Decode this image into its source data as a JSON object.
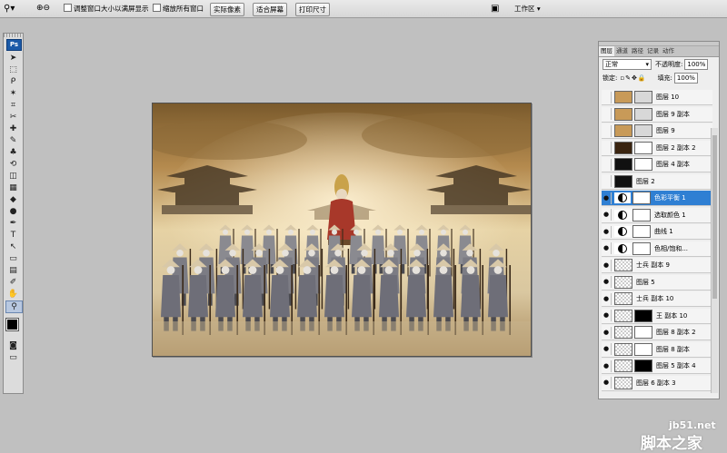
{
  "options_bar": {
    "zoom_tool_icon": "magnifier-icon",
    "resize_windows_label": "调整窗口大小以满屏显示",
    "zoom_all_windows_label": "缩放所有窗口",
    "actual_pixels_label": "实际像素",
    "fit_screen_label": "适合屏幕",
    "print_size_label": "打印尺寸",
    "workspace_label": "工作区 ▾"
  },
  "toolbox": {
    "ps_logo": "Ps",
    "tools": [
      "move-icon",
      "marquee-icon",
      "lasso-icon",
      "magic-wand-icon",
      "crop-icon",
      "slice-icon",
      "healing-brush-icon",
      "brush-icon",
      "clone-stamp-icon",
      "history-brush-icon",
      "eraser-icon",
      "gradient-icon",
      "blur-icon",
      "dodge-icon",
      "pen-icon",
      "type-icon",
      "path-select-icon",
      "shape-icon",
      "notes-icon",
      "eyedropper-icon",
      "hand-icon",
      "zoom-icon"
    ],
    "tool_glyphs": [
      "➤",
      "⬚",
      "ᑭ",
      "✶",
      "⌗",
      "✂",
      "✚",
      "✎",
      "♣",
      "⟲",
      "◫",
      "▦",
      "◆",
      "●",
      "✒",
      "T",
      "↖",
      "▭",
      "▤",
      "✐",
      "✋",
      "⚲"
    ],
    "foreground_color": "#000000",
    "background_color": "#ffffff"
  },
  "layers_panel": {
    "tabs": [
      "图层",
      "通道",
      "路径",
      "记录",
      "动作"
    ],
    "blend_mode": "正常",
    "opacity_label": "不透明度:",
    "opacity_value": "100%",
    "lock_label": "锁定:",
    "fill_label": "填充:",
    "fill_value": "100%",
    "layers": [
      {
        "name": "图层 10",
        "visible": false,
        "selected": false,
        "thumb": "#c89a58",
        "mask": "#d8d8d8"
      },
      {
        "name": "图层 9 副本",
        "visible": false,
        "selected": false,
        "thumb": "#c89a58",
        "mask": "#d8d8d8"
      },
      {
        "name": "图层 9",
        "visible": false,
        "selected": false,
        "thumb": "#c89a58",
        "mask": "#d8d8d8"
      },
      {
        "name": "图层 2 副本 2",
        "visible": false,
        "selected": false,
        "thumb": "#3a2410",
        "mask": "#ffffff"
      },
      {
        "name": "图层 4 副本",
        "visible": false,
        "selected": false,
        "thumb": "#111111",
        "mask": "#ffffff"
      },
      {
        "name": "图层 2",
        "visible": false,
        "selected": false,
        "thumb": "#111111",
        "mask": ""
      },
      {
        "name": "色彩平衡 1",
        "visible": true,
        "selected": true,
        "thumb": "adj",
        "mask": "#ffffff"
      },
      {
        "name": "选取颜色 1",
        "visible": true,
        "selected": false,
        "thumb": "adj",
        "mask": "#ffffff"
      },
      {
        "name": "曲线 1",
        "visible": true,
        "selected": false,
        "thumb": "adj",
        "mask": "#ffffff"
      },
      {
        "name": "色相/饱和...",
        "visible": true,
        "selected": false,
        "thumb": "adj",
        "mask": "#ffffff"
      },
      {
        "name": "士兵 副本 9",
        "visible": true,
        "selected": false,
        "thumb": "checker",
        "mask": ""
      },
      {
        "name": "图层 5",
        "visible": true,
        "selected": false,
        "thumb": "checker",
        "mask": ""
      },
      {
        "name": "士兵 副本 10",
        "visible": true,
        "selected": false,
        "thumb": "checker",
        "mask": ""
      },
      {
        "name": "王 副本 10",
        "visible": true,
        "selected": false,
        "thumb": "checker",
        "mask": "#000000"
      },
      {
        "name": "图层 8 副本 2",
        "visible": true,
        "selected": false,
        "thumb": "checker",
        "mask": "#ffffff"
      },
      {
        "name": "图层 8 副本",
        "visible": true,
        "selected": false,
        "thumb": "checker",
        "mask": "#ffffff"
      },
      {
        "name": "图层 5 副本 4",
        "visible": true,
        "selected": false,
        "thumb": "checker",
        "mask": "#000000"
      },
      {
        "name": "图层 6 副本 3",
        "visible": true,
        "selected": false,
        "thumb": "checker",
        "mask": ""
      }
    ]
  },
  "watermark": {
    "line1": "jb51.net",
    "line2": "脚本之家"
  }
}
